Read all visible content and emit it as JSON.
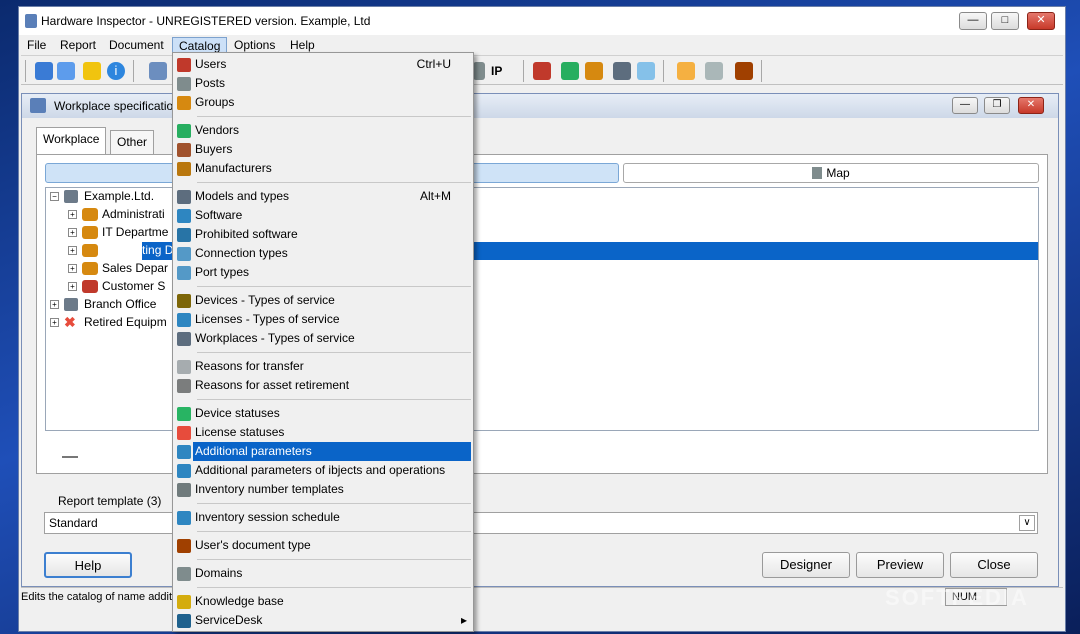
{
  "window": {
    "title": "Hardware Inspector - UNREGISTERED version. Example, Ltd"
  },
  "menubar": [
    "File",
    "Report",
    "Document",
    "Catalog",
    "Options",
    "Help"
  ],
  "toolbar": {
    "ip_label": "IP"
  },
  "child": {
    "title": "Workplace specification",
    "tabs": [
      "Workplace",
      "Other"
    ],
    "map_label": "Map",
    "tree": [
      {
        "label": "Example.Ltd.",
        "level": 0
      },
      {
        "label": "Administrati",
        "level": 1
      },
      {
        "label": "IT Departme",
        "level": 1
      },
      {
        "label": "Accounting D",
        "level": 1
      },
      {
        "label": "Sales Depar",
        "level": 1
      },
      {
        "label": "Customer S",
        "level": 1
      },
      {
        "label": "Branch Office",
        "level": 0
      },
      {
        "label": "Retired Equipm",
        "level": 0
      }
    ],
    "report_template_label": "Report template (3)",
    "report_template_value": "Standard",
    "buttons": {
      "help": "Help",
      "designer": "Designer",
      "preview": "Preview",
      "close": "Close"
    }
  },
  "status": {
    "text": "Edits the catalog of name additi",
    "num": "NUM"
  },
  "watermark": "SOFTPEDIA",
  "catalog_menu": [
    {
      "label": "Users",
      "shortcut": "Ctrl+U",
      "icon": "user-icon",
      "color": "#c0392b"
    },
    {
      "label": "Posts",
      "icon": "posts-icon",
      "color": "#7f8c8d"
    },
    {
      "label": "Groups",
      "icon": "groups-icon",
      "color": "#d68910"
    },
    {
      "sep": true
    },
    {
      "label": "Vendors",
      "icon": "vendor-icon",
      "color": "#27ae60"
    },
    {
      "label": "Buyers",
      "icon": "buyer-icon",
      "color": "#a0522d"
    },
    {
      "label": "Manufacturers",
      "icon": "factory-icon",
      "color": "#b9770e"
    },
    {
      "sep": true
    },
    {
      "label": "Models and types",
      "shortcut": "Alt+M",
      "icon": "models-icon",
      "color": "#5d6d7e"
    },
    {
      "label": "Software",
      "icon": "software-icon",
      "color": "#2e86c1"
    },
    {
      "label": "Prohibited software",
      "icon": "prohibited-icon",
      "color": "#2874a6"
    },
    {
      "label": "Connection types",
      "icon": "connection-icon",
      "color": "#5499c7"
    },
    {
      "label": "Port types",
      "icon": "port-icon",
      "color": "#5499c7"
    },
    {
      "sep": true
    },
    {
      "label": "Devices - Types of service",
      "icon": "tools-icon",
      "color": "#7d6608"
    },
    {
      "label": "Licenses - Types of service",
      "icon": "license-service-icon",
      "color": "#2e86c1"
    },
    {
      "label": "Workplaces - Types of service",
      "icon": "workplace-service-icon",
      "color": "#5d6d7e"
    },
    {
      "sep": true
    },
    {
      "label": "Reasons for transfer",
      "icon": "transfer-icon",
      "color": "#a6acaf"
    },
    {
      "label": "Reasons for asset retirement",
      "icon": "retire-icon",
      "color": "#7b7d7d"
    },
    {
      "sep": true
    },
    {
      "label": "Device statuses",
      "icon": "device-status-icon",
      "color": "#28b463"
    },
    {
      "label": "License statuses",
      "icon": "license-status-icon",
      "color": "#e74c3c"
    },
    {
      "label": "Additional parameters",
      "icon": "params-icon",
      "color": "#2e86c1",
      "highlight": true
    },
    {
      "label": "Additional parameters of ibjects and operations",
      "icon": "params-ops-icon",
      "color": "#2e86c1"
    },
    {
      "label": "Inventory number templates",
      "icon": "template-icon",
      "color": "#707b7c"
    },
    {
      "sep": true
    },
    {
      "label": "Inventory session schedule",
      "icon": "schedule-icon",
      "color": "#2e86c1"
    },
    {
      "sep": true
    },
    {
      "label": "User's document type",
      "icon": "doc-type-icon",
      "color": "#a04000"
    },
    {
      "sep": true
    },
    {
      "label": "Domains",
      "icon": "domains-icon",
      "color": "#7f8c8d"
    },
    {
      "sep": true
    },
    {
      "label": "Knowledge base",
      "icon": "knowledge-icon",
      "color": "#d4ac0d"
    },
    {
      "label": "ServiceDesk",
      "icon": "servicedesk-icon",
      "color": "#1f618d",
      "submenu": true
    }
  ]
}
